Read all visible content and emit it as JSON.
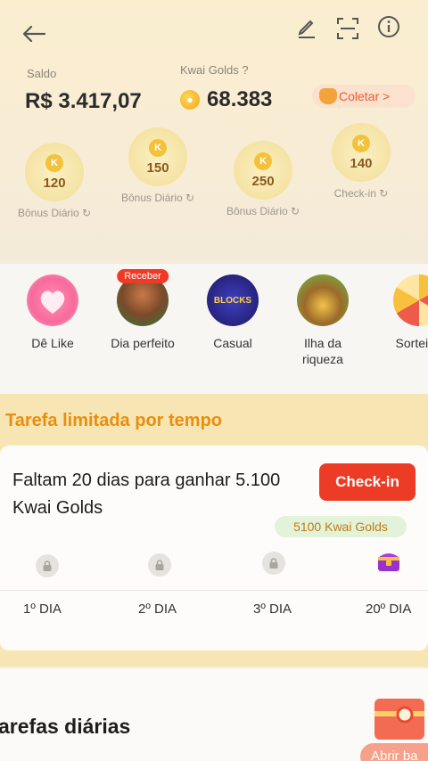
{
  "balance": {
    "saldo_label": "Saldo",
    "saldo_value": "R$ 3.417,07",
    "golds_label": "Kwai Golds ?",
    "golds_value": "68.383",
    "collect_label": "Coletar >"
  },
  "bonuses": [
    {
      "amount": "120",
      "caption": "Bônus Diário ↻"
    },
    {
      "amount": "150",
      "caption": "Bônus Diário ↻"
    },
    {
      "amount": "250",
      "caption": "Bônus Diário ↻"
    },
    {
      "amount": "140",
      "caption": "Check-in ↻"
    }
  ],
  "shortcuts": [
    {
      "label": "Dê Like"
    },
    {
      "label": "Dia perfeito",
      "badge": "Receber"
    },
    {
      "label": "Casual",
      "art_text": "BLOCKS"
    },
    {
      "label": "Ilha da riqueza"
    },
    {
      "label": "Sorteio ("
    }
  ],
  "limited": {
    "title": "Tarefa limitada por tempo",
    "task_text": "Faltam 20 dias para ganhar 5.100 Kwai Golds",
    "checkin_label": "Check-in",
    "reward_pill": "5100 Kwai Golds",
    "days": [
      "1º DIA",
      "2º DIA",
      "3º DIA",
      "20º DIA"
    ]
  },
  "daily": {
    "title": "arefas diárias",
    "open_label": "Abrir ba"
  },
  "colors": {
    "accent_red": "#ec3c25",
    "gold_orange": "#e98e0f",
    "limited_bg": "#f7e6b3"
  }
}
